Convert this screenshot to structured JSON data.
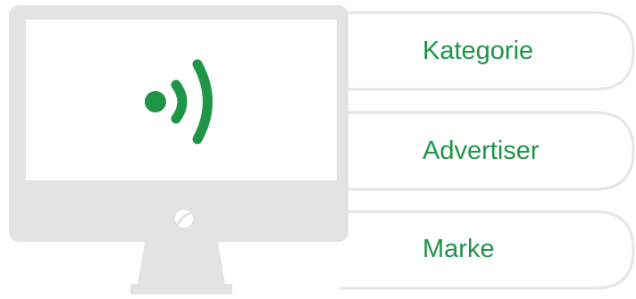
{
  "colors": {
    "accent": "#1f9548",
    "monitor": "#e3e3e3",
    "tab_border": "#e6e6e6",
    "background": "#ffffff"
  },
  "monitor": {
    "screen_icon": "wifi-broadcast-icon",
    "logo_icon": "power-logo-icon"
  },
  "tabs": [
    {
      "label": "Kategorie"
    },
    {
      "label": "Advertiser"
    },
    {
      "label": "Marke"
    }
  ]
}
